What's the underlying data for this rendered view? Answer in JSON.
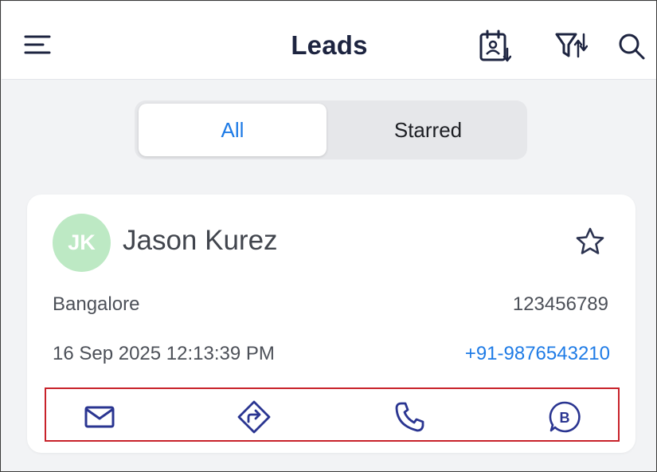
{
  "header": {
    "title": "Leads",
    "icons": {
      "menu": "hamburger-menu-icon",
      "calendar": "calendar-contact-download-icon",
      "filter": "filter-sort-icon",
      "search": "search-icon"
    }
  },
  "tabs": [
    {
      "label": "All",
      "selected": true
    },
    {
      "label": "Starred",
      "selected": false
    }
  ],
  "lead": {
    "initials": "JK",
    "name": "Jason Kurez",
    "city": "Bangalore",
    "lead_id": "123456789",
    "datetime": "16 Sep 2025 12:13:39 PM",
    "phone": "+91-9876543210",
    "starred": false
  },
  "actions": [
    {
      "icon": "mail-icon"
    },
    {
      "icon": "directions-icon"
    },
    {
      "icon": "phone-icon"
    },
    {
      "icon": "business-chat-icon"
    }
  ],
  "colors": {
    "accent_blue": "#1e7be6",
    "icon_navy": "#2a3591",
    "title_navy": "#1d2440",
    "avatar_green": "#bde9c4",
    "highlight_red": "#c8222a"
  }
}
